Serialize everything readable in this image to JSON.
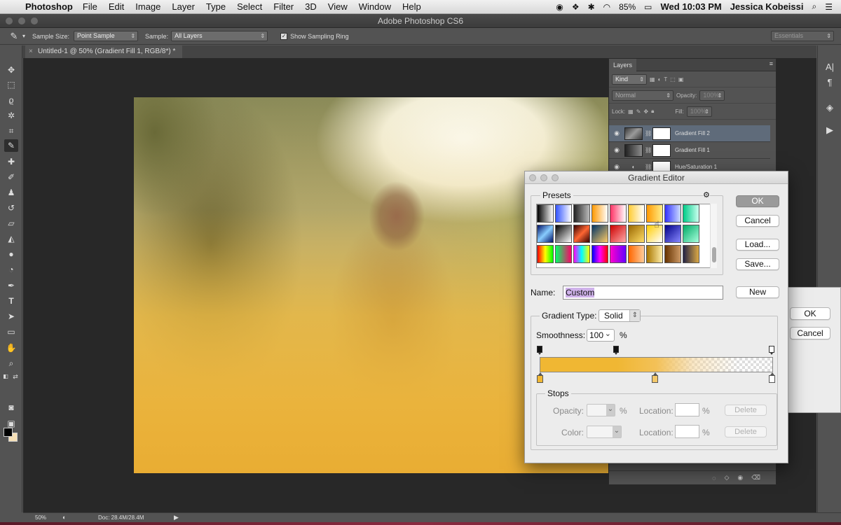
{
  "menubar": {
    "app_name": "Photoshop",
    "items": [
      "File",
      "Edit",
      "Image",
      "Layer",
      "Type",
      "Select",
      "Filter",
      "3D",
      "View",
      "Window",
      "Help"
    ],
    "battery": "85%",
    "clock": "Wed 10:03 PM",
    "user": "Jessica Kobeissi"
  },
  "window": {
    "title": "Adobe Photoshop CS6"
  },
  "options_bar": {
    "sample_size_label": "Sample Size:",
    "sample_size_value": "Point Sample",
    "sample_label": "Sample:",
    "sample_value": "All Layers",
    "show_sampling_ring": "Show Sampling Ring",
    "workspace": "Essentials"
  },
  "document_tab": {
    "title": "Untitled-1 @ 50% (Gradient Fill 1, RGB/8*) *"
  },
  "status_bar": {
    "zoom": "50%",
    "doc_size": "Doc: 28.4M/28.4M"
  },
  "layers_panel": {
    "tab": "Layers",
    "kind": "Kind",
    "blend_mode": "Normal",
    "opacity_label": "Opacity:",
    "opacity_value": "100%",
    "lock_label": "Lock:",
    "fill_label": "Fill:",
    "fill_value": "100%",
    "layers": [
      {
        "name": "Gradient Fill 2",
        "selected": true
      },
      {
        "name": "Gradient Fill 1",
        "selected": false
      },
      {
        "name": "Hue/Saturation 1",
        "selected": false
      }
    ]
  },
  "behind_dialog": {
    "ok": "OK",
    "cancel": "Cancel"
  },
  "gradient_editor": {
    "title": "Gradient Editor",
    "presets_label": "Presets",
    "buttons": {
      "ok": "OK",
      "cancel": "Cancel",
      "load": "Load...",
      "save": "Save...",
      "new": "New"
    },
    "name_label": "Name:",
    "name_value": "Custom",
    "gradient_type_label": "Gradient Type:",
    "gradient_type_value": "Solid",
    "smoothness_label": "Smoothness:",
    "smoothness_value": "100",
    "smoothness_unit": "%",
    "stops": {
      "label": "Stops",
      "opacity_label": "Opacity:",
      "color_label": "Color:",
      "location_label": "Location:",
      "percent": "%",
      "delete": "Delete"
    },
    "gradient_color": "#f0b733"
  }
}
